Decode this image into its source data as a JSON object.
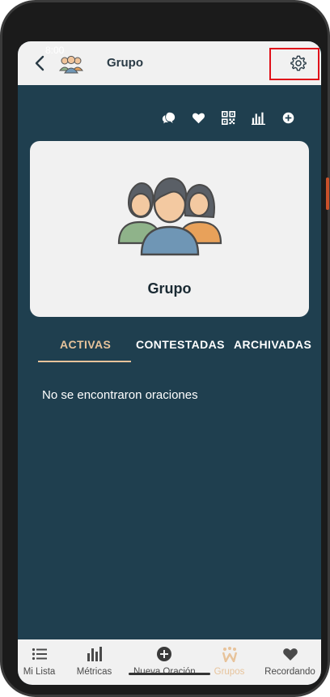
{
  "status": {
    "time": "8:00"
  },
  "appbar": {
    "title": "Grupo",
    "back_icon": "chevron-left-icon",
    "settings_icon": "gear-icon"
  },
  "actions": [
    {
      "icon": "chat-bubbles-icon"
    },
    {
      "icon": "heart-icon"
    },
    {
      "icon": "qr-code-icon"
    },
    {
      "icon": "bar-chart-icon"
    },
    {
      "icon": "plus-circle-icon"
    }
  ],
  "card": {
    "name": "Grupo",
    "art": "group-people-icon"
  },
  "tabs": [
    {
      "label": "ACTIVAS",
      "active": true
    },
    {
      "label": "CONTESTADAS",
      "active": false
    },
    {
      "label": "ARCHIVADAS",
      "active": false
    }
  ],
  "empty_message": "No se encontraron oraciones",
  "bottom_nav": [
    {
      "label": "Mi Lista",
      "icon": "list-icon"
    },
    {
      "label": "Métricas",
      "icon": "bar-chart-icon"
    },
    {
      "label": "Nueva Oración",
      "icon": "plus-circle-icon"
    },
    {
      "label": "Grupos",
      "icon": "groups-icon",
      "active": true
    },
    {
      "label": "Recordando",
      "icon": "heart-icon"
    }
  ],
  "colors": {
    "background": "#1f3f4f",
    "accent": "#e7c39b",
    "surface": "#f1f1f1",
    "highlight": "#e0101a"
  }
}
